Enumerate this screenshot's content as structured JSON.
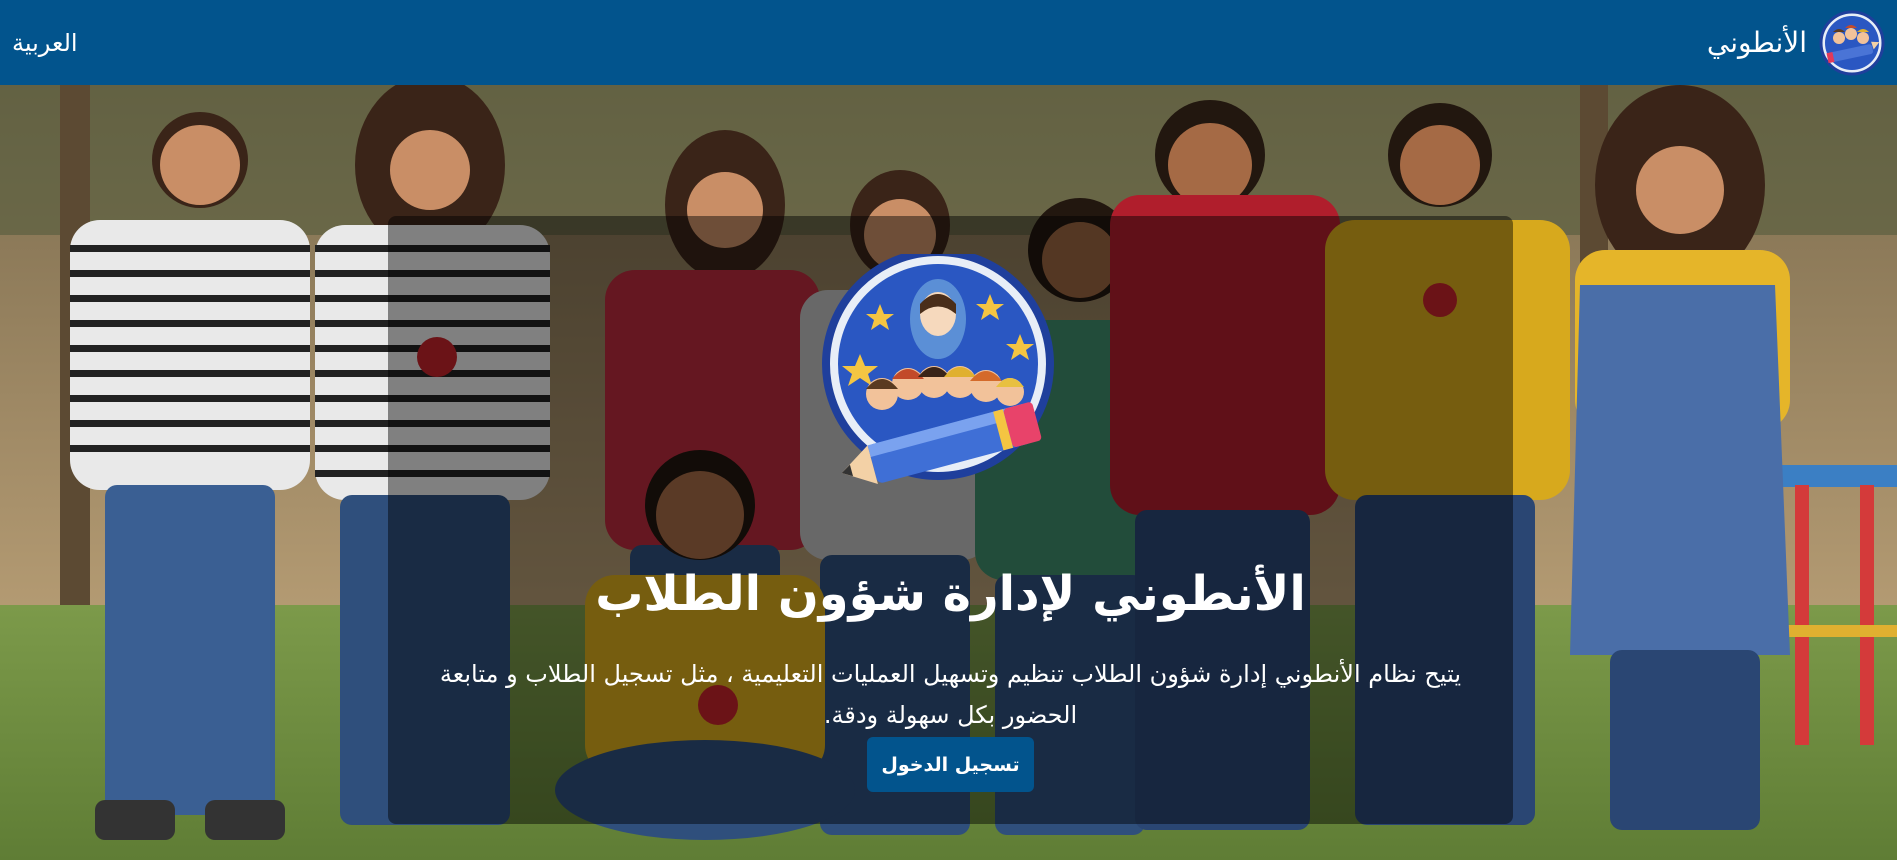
{
  "navbar": {
    "brand_name": "الأنطوني",
    "language_link": "العربية",
    "brand_logo_icon": "school-kids-pencil-logo",
    "background_color": "#02548d"
  },
  "hero": {
    "title": "الأنطوني لإدارة شؤون الطلاب",
    "description": "يتيح نظام الأنطوني إدارة شؤون الطلاب تنظيم وتسهيل العمليات التعليمية ، مثل تسجيل الطلاب و متابعة الحضور بكل سهولة ودقة.",
    "login_label": "تسجيل الدخول",
    "logo_icon": "virgin-mary-kids-pencil-logo",
    "background_image": "children-playground-photo",
    "accent_color": "#02548d"
  }
}
